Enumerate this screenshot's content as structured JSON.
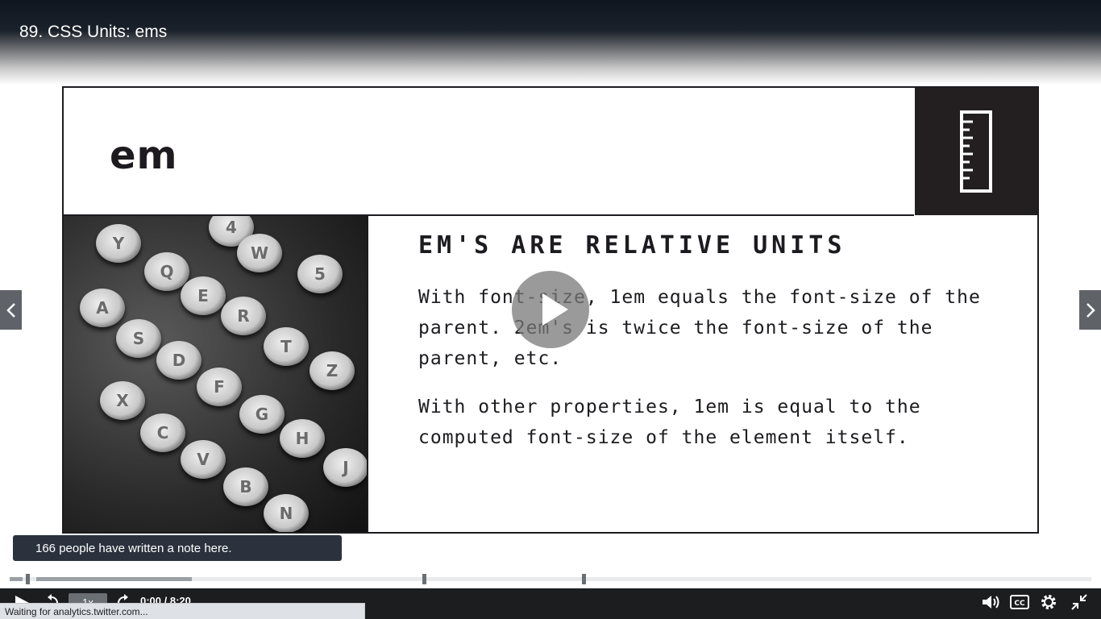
{
  "video": {
    "title": "89. CSS Units: ems"
  },
  "slide": {
    "heading": "em",
    "section_title": "EM'S ARE RELATIVE UNITS",
    "paragraphs": [
      "With font-size, 1em equals the font-size of the parent.  2em's is twice the font-size of the parent, etc.",
      "With other properties, 1em is equal to the computed font-size of the element itself."
    ],
    "icon": "ruler-icon",
    "image": "typewriter-keys-photo",
    "typewriter_keys": [
      "A",
      "Q",
      "S",
      "W",
      "E",
      "D",
      "R",
      "F",
      "T",
      "X",
      "C",
      "V",
      "B",
      "G",
      "H",
      "Z",
      "N",
      "J",
      "Y",
      "4",
      "5"
    ]
  },
  "notes": {
    "banner_text": "166 people have written a note here."
  },
  "player": {
    "speed_label": "1x",
    "time_display": "0:00 / 8:20",
    "progress_fraction": 0.0,
    "controls_icons": [
      "play-icon",
      "rewind-icon",
      "forward-icon",
      "volume-icon",
      "captions-icon",
      "settings-icon",
      "exit-fullscreen-icon"
    ]
  },
  "browser": {
    "status_text": "Waiting for analytics.twitter.com..."
  },
  "colors": {
    "slide_dark": "#231f20",
    "control_bar": "#1c1d1f",
    "notes_banner": "#2b323d"
  }
}
